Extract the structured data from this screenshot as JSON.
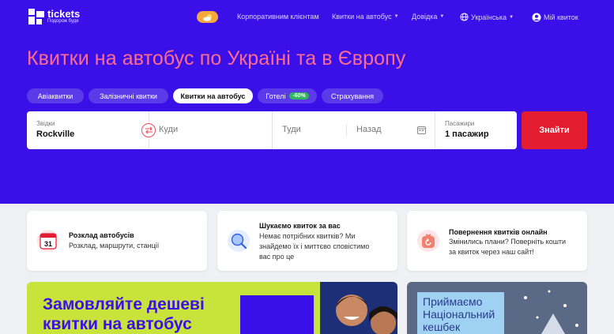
{
  "header": {
    "logo_name": "tickets",
    "logo_tagline": "Подорож буде",
    "nav": {
      "corporate": "Корпоративним клієнтам",
      "bus_tickets": "Квитки на автобус",
      "help": "Довідка",
      "language": "Українська",
      "my_ticket": "Мій квиток"
    }
  },
  "hero": {
    "headline": "Квитки на автобус по Україні та в Європу"
  },
  "tabs": [
    {
      "label": "Авіаквитки"
    },
    {
      "label": "Залізничні квитки"
    },
    {
      "label": "Квитки на автобус"
    },
    {
      "label": "Готелі",
      "badge": "-60%"
    },
    {
      "label": "Страхування"
    }
  ],
  "search": {
    "from_label": "Звідки",
    "from_value": "Rockville",
    "to_placeholder": "Куди",
    "date_there_placeholder": "Туди",
    "date_back_placeholder": "Назад",
    "passengers_label": "Пасажири",
    "passengers_value": "1 пасажир",
    "submit": "Знайти"
  },
  "cards": [
    {
      "title": "Розклад автобусів",
      "lines": [
        "Розклад, маршрути, станції"
      ],
      "icon_text": "31"
    },
    {
      "title": "Шукаємо квиток за вас",
      "lines": [
        "Немає потрібних квитків? Ми",
        "знайдемо їх і миттєво сповістимо",
        "вас про це"
      ]
    },
    {
      "title": "Повернення квитків онлайн",
      "lines": [
        "Змінились плани? Поверніть кошти",
        "за квиток через наш сайт!"
      ]
    }
  ],
  "banners": {
    "left_lines": [
      "Замовляйте дешеві",
      "квитки на автобус"
    ],
    "right_lines": [
      "Приймаємо",
      "Національний",
      "кешбек"
    ]
  },
  "colors": {
    "hero_bg": "#3b10e8",
    "headline": "#ff6b8e",
    "cta": "#e41c2f",
    "discount": "#2fb55c"
  }
}
